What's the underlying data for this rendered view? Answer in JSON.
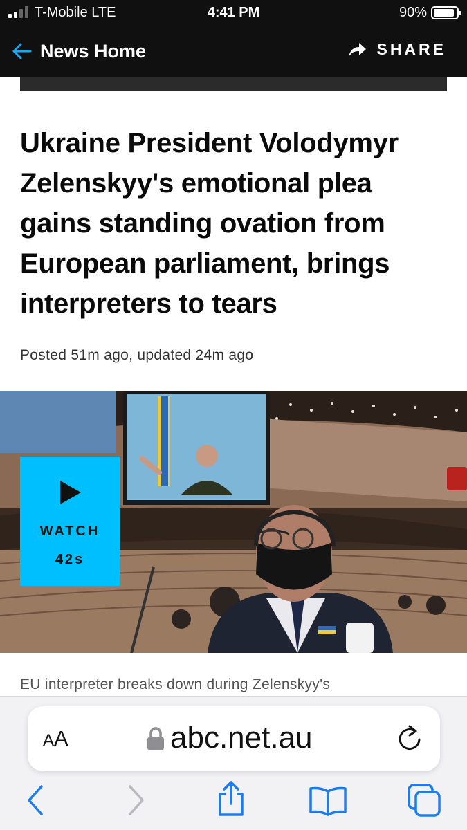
{
  "status_bar": {
    "carrier": "T-Mobile  LTE",
    "time": "4:41 PM",
    "battery": "90%"
  },
  "header": {
    "back_label": "News Home",
    "share_label": "SHARE"
  },
  "article": {
    "headline": "Ukraine President Volodymyr Zelenskyy's emotional plea gains standing ovation from European parliament, brings interpreters to tears",
    "posted": "Posted 51m ago, updated 24m ago",
    "watch_label": "WATCH",
    "watch_duration": "42s",
    "caption": "EU interpreter breaks down during Zelenskyy's"
  },
  "browser": {
    "aa_small": "A",
    "aa_large": "A",
    "url": "abc.net.au"
  },
  "colors": {
    "accent": "#00bfff",
    "header_bg": "#101010",
    "link_blue": "#1a7cf0"
  },
  "icons": {
    "back": "arrow-left-icon",
    "share": "share-arrow-icon",
    "play": "play-icon",
    "lock": "lock-icon",
    "reload": "reload-icon",
    "nav_back": "chevron-left-icon",
    "nav_forward": "chevron-right-icon",
    "share_sheet": "share-box-icon",
    "bookmarks": "book-icon",
    "tabs": "tabs-icon"
  }
}
